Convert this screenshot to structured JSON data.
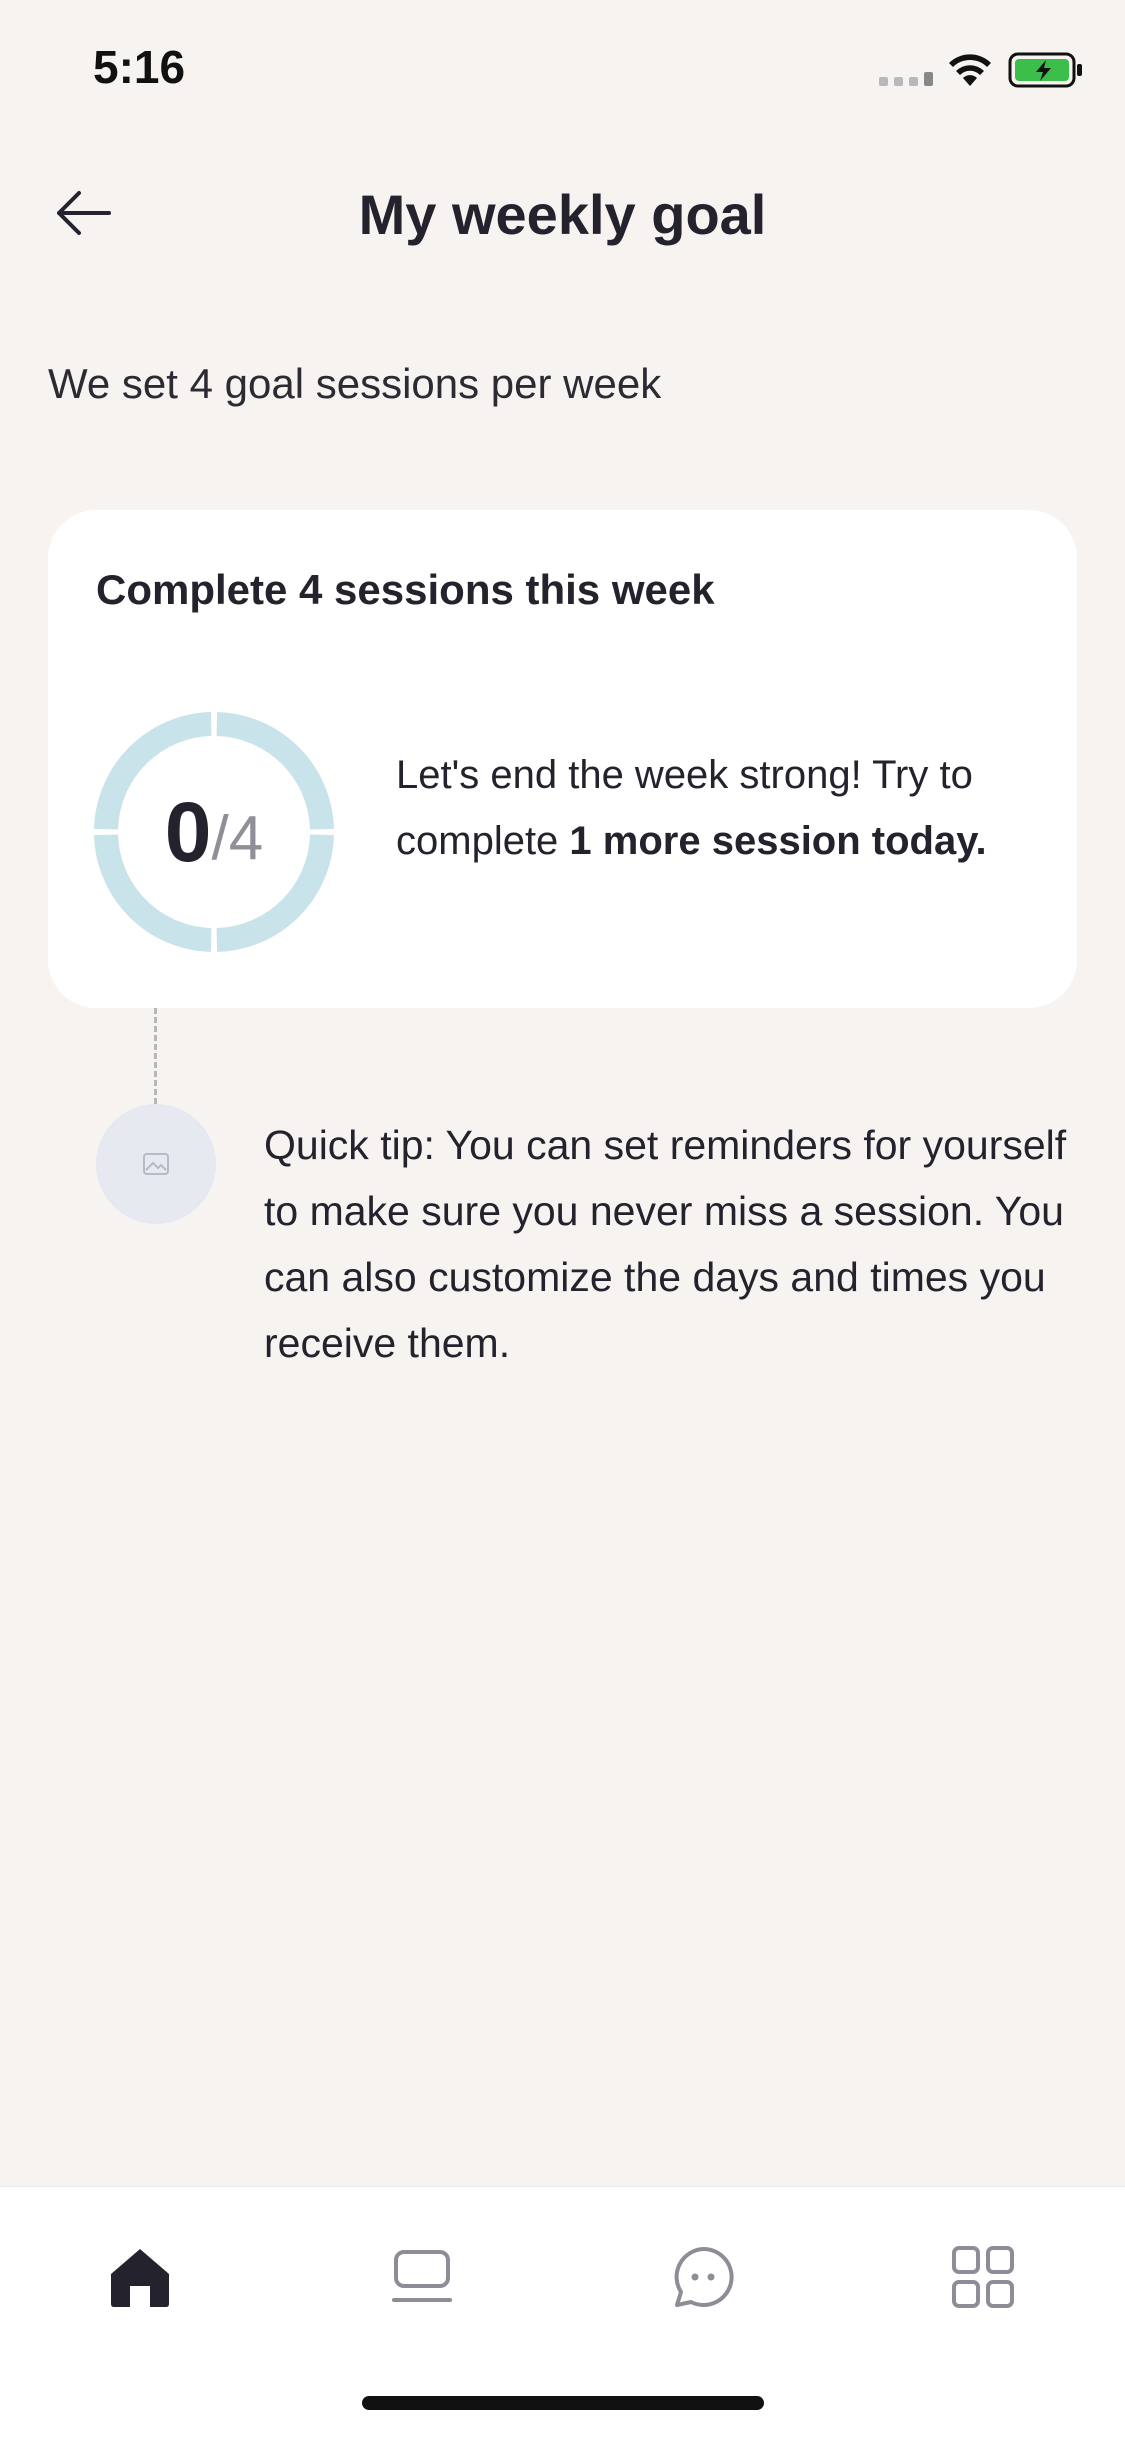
{
  "status_bar": {
    "time": "5:16",
    "battery_color": "#3bbf4a"
  },
  "header": {
    "title": "My weekly goal",
    "back_icon": "arrow-left-icon"
  },
  "subtitle": "We set 4 goal sessions per week",
  "goal_card": {
    "title": "Complete 4 sessions this week",
    "completed": "0",
    "total_label": "/4",
    "progress_fraction": 0,
    "segments": 4,
    "ring_color": "#c9e3ea",
    "message_prefix": "Let's end the week strong! Try to complete ",
    "message_bold": "1 more session today."
  },
  "tip": {
    "avatar_icon": "image-placeholder-icon",
    "text": "Quick tip: You can set reminders for yourself to make sure you never miss a session. You can also customize the days and times you receive them."
  },
  "tab_bar": {
    "items": [
      {
        "icon": "home-icon",
        "active": true
      },
      {
        "icon": "sessions-icon",
        "active": false
      },
      {
        "icon": "chat-icon",
        "active": false
      },
      {
        "icon": "grid-menu-icon",
        "active": false
      }
    ]
  }
}
